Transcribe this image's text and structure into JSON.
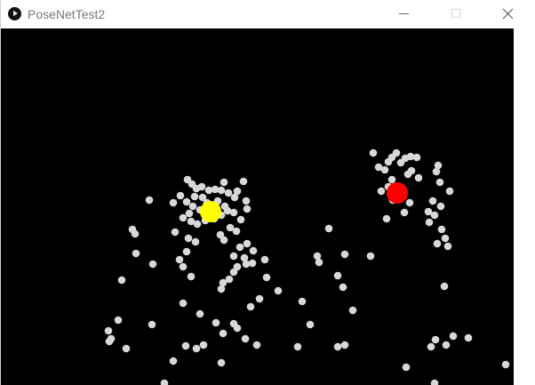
{
  "window": {
    "title": "PoseNetTest2"
  },
  "icons": {
    "app": "processing-app-icon",
    "minimize": "minimize-icon",
    "maximize": "maximize-icon",
    "close": "close-icon"
  },
  "colors": {
    "canvas_bg": "#000000",
    "particle": "#d8d8d8",
    "marker_left": "#ffff00",
    "marker_right": "#ff0000"
  }
}
